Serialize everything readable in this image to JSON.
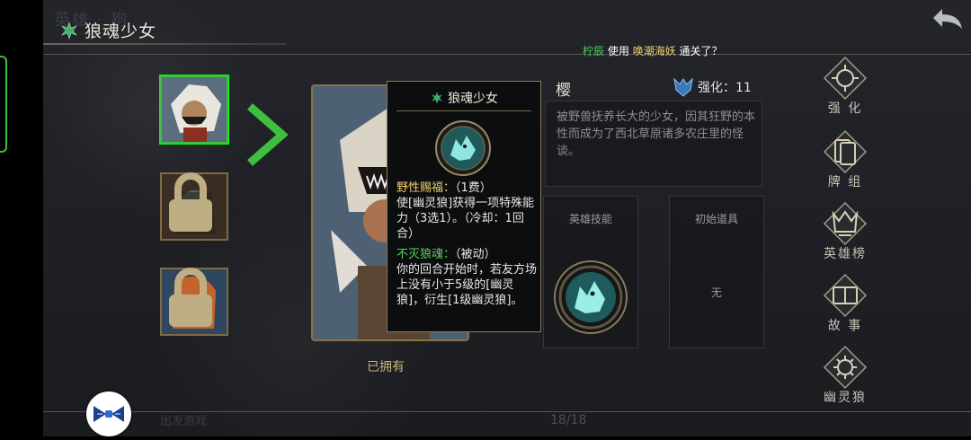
{
  "header": {
    "ghost_text": "英雄 · 狗",
    "title": "狼魂少女",
    "back_icon": "back-arrow-icon"
  },
  "notice": {
    "player": "柠辰",
    "mid": "使用",
    "hero": "唤潮海妖",
    "suffix": "通关了？"
  },
  "portraits": [
    {
      "name": "portrait-wolf-girl",
      "selected": true,
      "locked": false
    },
    {
      "name": "portrait-locked-1",
      "selected": false,
      "locked": true
    },
    {
      "name": "portrait-locked-2",
      "selected": false,
      "locked": true
    }
  ],
  "card": {
    "owned_label": "已拥有"
  },
  "tooltip": {
    "title": "狼魂少女",
    "ability1_name": "野性赐福：",
    "ability1_cost": "（1费）",
    "ability1_text": "使[幽灵狼]获得一项特殊能力（3选1）。（冷却：1回合）",
    "ability2_name": "不灭狼魂：",
    "ability2_type": "（被动）",
    "ability2_text": "你的回合开始时，若友方场上没有小于5级的[幽灵狼]，衍生[1级幽灵狼]。"
  },
  "hero": {
    "name": "樱",
    "enhance_label": "强化：11",
    "description": "被野兽抚养长大的少女，因其狂野的本性而成为了西北草原诸多农庄里的怪谈。"
  },
  "skill_panel": {
    "label": "英雄技能"
  },
  "item_panel": {
    "label": "初始道具",
    "value": "无"
  },
  "menu": [
    {
      "label": "强 化",
      "icon": "enhance-icon"
    },
    {
      "label": "牌 组",
      "icon": "deck-icon"
    },
    {
      "label": "英雄榜",
      "icon": "hero-ranking-icon"
    },
    {
      "label": "故 事",
      "icon": "story-icon"
    },
    {
      "label": "幽灵狼",
      "icon": "ghost-wolf-icon"
    }
  ],
  "footer": {
    "page_count": "18/18",
    "ghost_text": "出发游戏"
  },
  "colors": {
    "green_highlight": "#3fd35a",
    "gold_highlight": "#f2d36b",
    "frame_gold": "#8a7346"
  }
}
